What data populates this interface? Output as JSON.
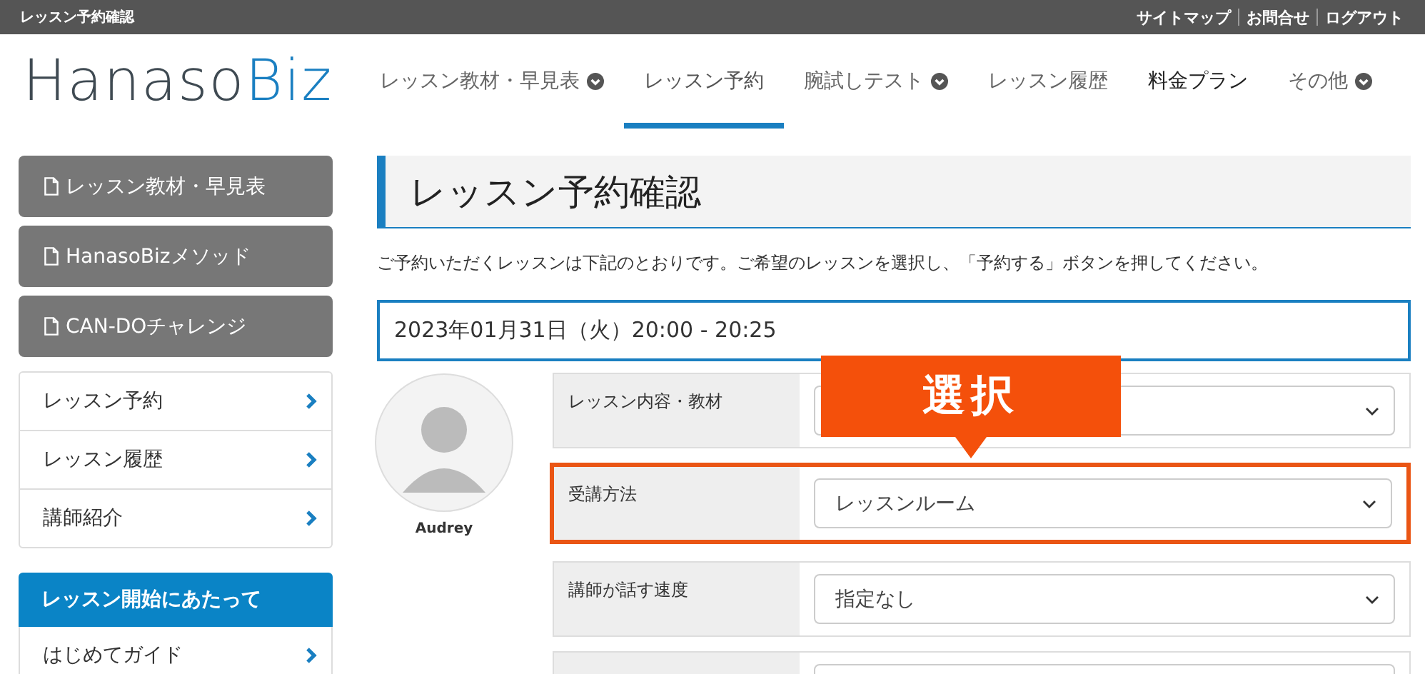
{
  "top_bar": {
    "page_title": "レッスン予約確認",
    "links": [
      "サイトマップ",
      "お問合せ",
      "ログアウト"
    ]
  },
  "header": {
    "logo": {
      "part_1": "Hanaso",
      "part_2": "Biz"
    },
    "nav": [
      {
        "label": "レッスン教材・早見表",
        "dropdown": true,
        "selected": false,
        "emphasized": false
      },
      {
        "label": "レッスン予約",
        "dropdown": false,
        "selected": true,
        "emphasized": false
      },
      {
        "label": "腕試しテスト",
        "dropdown": true,
        "selected": false,
        "emphasized": false
      },
      {
        "label": "レッスン履歴",
        "dropdown": false,
        "selected": false,
        "emphasized": false
      },
      {
        "label": "料金プラン",
        "dropdown": false,
        "selected": false,
        "emphasized": true
      },
      {
        "label": "その他",
        "dropdown": true,
        "selected": false,
        "emphasized": false
      }
    ]
  },
  "sidebar": {
    "buttons": [
      "レッスン教材・早見表",
      "HanasoBizメソッド",
      "CAN-DOチャレンジ"
    ],
    "links": [
      "レッスン予約",
      "レッスン履歴",
      "講師紹介"
    ],
    "section": {
      "title": "レッスン開始にあたって",
      "links": [
        "はじめてガイド"
      ]
    }
  },
  "main": {
    "title": "レッスン予約確認",
    "intro": "ご予約いただくレッスンは下記のとおりです。ご希望のレッスンを選択し、「予約する」ボタンを押してください。",
    "lesson_time": "2023年01月31日（火）20:00 - 20:25",
    "teacher": {
      "name": "Audrey"
    },
    "callout": "選択",
    "form": [
      {
        "label": "レッスン内容・教材",
        "highlighted": false
      },
      {
        "label": "受講方法",
        "value": "レッスンルーム",
        "highlighted": true
      },
      {
        "label": "講師が話す速度",
        "value": "指定なし",
        "highlighted": false
      },
      {
        "highlighted": false
      }
    ]
  }
}
